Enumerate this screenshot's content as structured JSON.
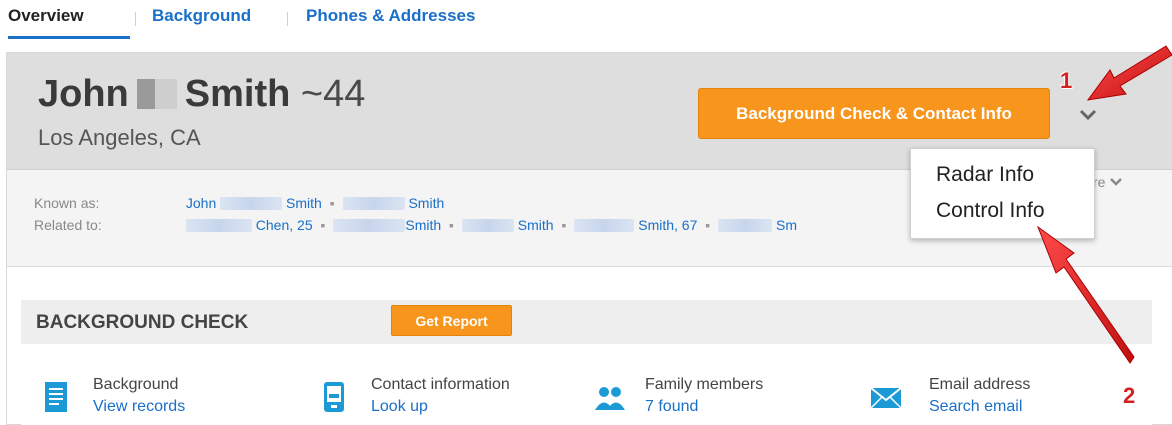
{
  "tabs": [
    {
      "label": "Overview",
      "active": true
    },
    {
      "label": "Background",
      "active": false
    },
    {
      "label": "Phones & Addresses",
      "active": false
    }
  ],
  "person": {
    "first_name": "John",
    "last_name": "Smith",
    "age": "~44",
    "location": "Los Angeles, CA"
  },
  "header": {
    "cta_label": "Background Check & Contact Info"
  },
  "known_as": {
    "label": "Known as:",
    "names": [
      "John",
      "Smith",
      "Smith"
    ]
  },
  "related_to": {
    "label": "Related to:",
    "names": [
      "Chen, 25",
      "Smith",
      "Smith",
      "Smith, 67",
      "Sm"
    ]
  },
  "more_label": "re",
  "dropdown": {
    "items": [
      "Radar Info",
      "Control Info"
    ]
  },
  "background_check": {
    "title": "BACKGROUND CHECK",
    "report_label": "Get Report",
    "features": [
      {
        "title": "Background",
        "action": "View records",
        "icon": "document-icon"
      },
      {
        "title": "Contact information",
        "action": "Look up",
        "icon": "phone-icon"
      },
      {
        "title": "Family members",
        "action": "7 found",
        "icon": "people-icon"
      },
      {
        "title": "Email address",
        "action": "Search email",
        "icon": "envelope-icon"
      }
    ]
  },
  "annotations": [
    "1",
    "2"
  ],
  "colors": {
    "accent_orange": "#f7951d",
    "link_blue": "#1a6fc9",
    "annotation_red": "#d42020"
  }
}
